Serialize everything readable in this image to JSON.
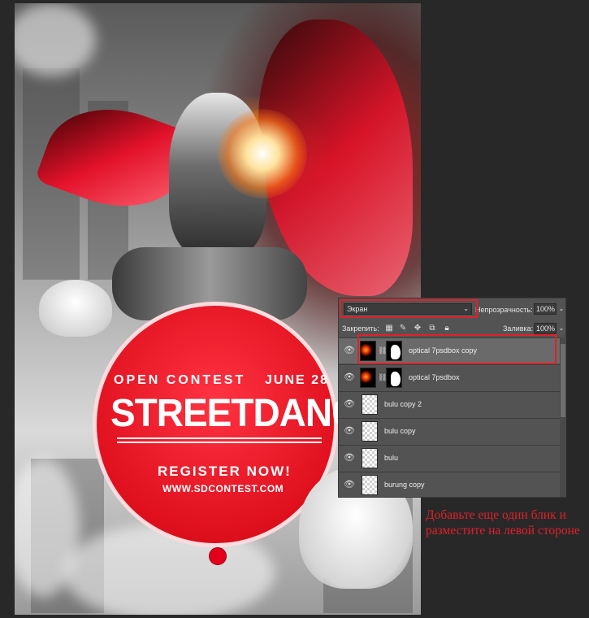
{
  "poster": {
    "contest_label": "OPEN CONTEST",
    "date_label": "JUNE 28",
    "title": "STREETDANCE",
    "register_label": "REGISTER NOW!",
    "url": "WWW.SDCONTEST.COM",
    "accent_color": "#e3122a"
  },
  "layers_panel": {
    "blend_mode": "Экран",
    "opacity_label": "Непрозрачность:",
    "opacity_value": "100%",
    "lock_label": "Закрепить:",
    "fill_label": "Заливка:",
    "fill_value": "100%",
    "lock_icons": [
      "lock-transparency-icon",
      "lock-image-icon",
      "lock-position-icon",
      "lock-artboard-icon",
      "lock-all-icon"
    ],
    "layers": [
      {
        "name": "optical 7psdbox copy",
        "visible": true,
        "selected": true,
        "thumb": "black",
        "mask": true
      },
      {
        "name": "optical 7psdbox",
        "visible": true,
        "selected": false,
        "thumb": "black",
        "mask": true
      },
      {
        "name": "bulu copy 2",
        "visible": true,
        "selected": false,
        "thumb": "transparent",
        "mask": false
      },
      {
        "name": "bulu copy",
        "visible": true,
        "selected": false,
        "thumb": "transparent",
        "mask": false
      },
      {
        "name": "bulu",
        "visible": true,
        "selected": false,
        "thumb": "transparent",
        "mask": false
      },
      {
        "name": "burung copy",
        "visible": true,
        "selected": false,
        "thumb": "transparent",
        "mask": false
      }
    ]
  },
  "instruction": "Добавьте еще один блик и разместите на левой стороне",
  "annotation_color": "#e0202a"
}
